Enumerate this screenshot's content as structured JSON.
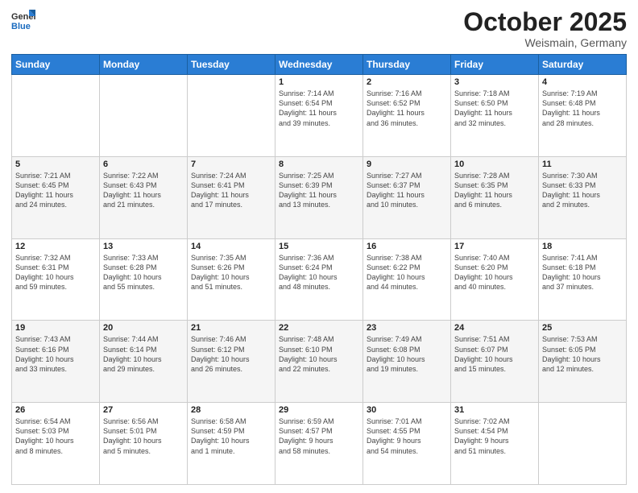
{
  "header": {
    "logo_general": "General",
    "logo_blue": "Blue",
    "month": "October 2025",
    "location": "Weismain, Germany"
  },
  "weekdays": [
    "Sunday",
    "Monday",
    "Tuesday",
    "Wednesday",
    "Thursday",
    "Friday",
    "Saturday"
  ],
  "weeks": [
    [
      {
        "day": "",
        "info": ""
      },
      {
        "day": "",
        "info": ""
      },
      {
        "day": "",
        "info": ""
      },
      {
        "day": "1",
        "info": "Sunrise: 7:14 AM\nSunset: 6:54 PM\nDaylight: 11 hours\nand 39 minutes."
      },
      {
        "day": "2",
        "info": "Sunrise: 7:16 AM\nSunset: 6:52 PM\nDaylight: 11 hours\nand 36 minutes."
      },
      {
        "day": "3",
        "info": "Sunrise: 7:18 AM\nSunset: 6:50 PM\nDaylight: 11 hours\nand 32 minutes."
      },
      {
        "day": "4",
        "info": "Sunrise: 7:19 AM\nSunset: 6:48 PM\nDaylight: 11 hours\nand 28 minutes."
      }
    ],
    [
      {
        "day": "5",
        "info": "Sunrise: 7:21 AM\nSunset: 6:45 PM\nDaylight: 11 hours\nand 24 minutes."
      },
      {
        "day": "6",
        "info": "Sunrise: 7:22 AM\nSunset: 6:43 PM\nDaylight: 11 hours\nand 21 minutes."
      },
      {
        "day": "7",
        "info": "Sunrise: 7:24 AM\nSunset: 6:41 PM\nDaylight: 11 hours\nand 17 minutes."
      },
      {
        "day": "8",
        "info": "Sunrise: 7:25 AM\nSunset: 6:39 PM\nDaylight: 11 hours\nand 13 minutes."
      },
      {
        "day": "9",
        "info": "Sunrise: 7:27 AM\nSunset: 6:37 PM\nDaylight: 11 hours\nand 10 minutes."
      },
      {
        "day": "10",
        "info": "Sunrise: 7:28 AM\nSunset: 6:35 PM\nDaylight: 11 hours\nand 6 minutes."
      },
      {
        "day": "11",
        "info": "Sunrise: 7:30 AM\nSunset: 6:33 PM\nDaylight: 11 hours\nand 2 minutes."
      }
    ],
    [
      {
        "day": "12",
        "info": "Sunrise: 7:32 AM\nSunset: 6:31 PM\nDaylight: 10 hours\nand 59 minutes."
      },
      {
        "day": "13",
        "info": "Sunrise: 7:33 AM\nSunset: 6:28 PM\nDaylight: 10 hours\nand 55 minutes."
      },
      {
        "day": "14",
        "info": "Sunrise: 7:35 AM\nSunset: 6:26 PM\nDaylight: 10 hours\nand 51 minutes."
      },
      {
        "day": "15",
        "info": "Sunrise: 7:36 AM\nSunset: 6:24 PM\nDaylight: 10 hours\nand 48 minutes."
      },
      {
        "day": "16",
        "info": "Sunrise: 7:38 AM\nSunset: 6:22 PM\nDaylight: 10 hours\nand 44 minutes."
      },
      {
        "day": "17",
        "info": "Sunrise: 7:40 AM\nSunset: 6:20 PM\nDaylight: 10 hours\nand 40 minutes."
      },
      {
        "day": "18",
        "info": "Sunrise: 7:41 AM\nSunset: 6:18 PM\nDaylight: 10 hours\nand 37 minutes."
      }
    ],
    [
      {
        "day": "19",
        "info": "Sunrise: 7:43 AM\nSunset: 6:16 PM\nDaylight: 10 hours\nand 33 minutes."
      },
      {
        "day": "20",
        "info": "Sunrise: 7:44 AM\nSunset: 6:14 PM\nDaylight: 10 hours\nand 29 minutes."
      },
      {
        "day": "21",
        "info": "Sunrise: 7:46 AM\nSunset: 6:12 PM\nDaylight: 10 hours\nand 26 minutes."
      },
      {
        "day": "22",
        "info": "Sunrise: 7:48 AM\nSunset: 6:10 PM\nDaylight: 10 hours\nand 22 minutes."
      },
      {
        "day": "23",
        "info": "Sunrise: 7:49 AM\nSunset: 6:08 PM\nDaylight: 10 hours\nand 19 minutes."
      },
      {
        "day": "24",
        "info": "Sunrise: 7:51 AM\nSunset: 6:07 PM\nDaylight: 10 hours\nand 15 minutes."
      },
      {
        "day": "25",
        "info": "Sunrise: 7:53 AM\nSunset: 6:05 PM\nDaylight: 10 hours\nand 12 minutes."
      }
    ],
    [
      {
        "day": "26",
        "info": "Sunrise: 6:54 AM\nSunset: 5:03 PM\nDaylight: 10 hours\nand 8 minutes."
      },
      {
        "day": "27",
        "info": "Sunrise: 6:56 AM\nSunset: 5:01 PM\nDaylight: 10 hours\nand 5 minutes."
      },
      {
        "day": "28",
        "info": "Sunrise: 6:58 AM\nSunset: 4:59 PM\nDaylight: 10 hours\nand 1 minute."
      },
      {
        "day": "29",
        "info": "Sunrise: 6:59 AM\nSunset: 4:57 PM\nDaylight: 9 hours\nand 58 minutes."
      },
      {
        "day": "30",
        "info": "Sunrise: 7:01 AM\nSunset: 4:55 PM\nDaylight: 9 hours\nand 54 minutes."
      },
      {
        "day": "31",
        "info": "Sunrise: 7:02 AM\nSunset: 4:54 PM\nDaylight: 9 hours\nand 51 minutes."
      },
      {
        "day": "",
        "info": ""
      }
    ]
  ]
}
